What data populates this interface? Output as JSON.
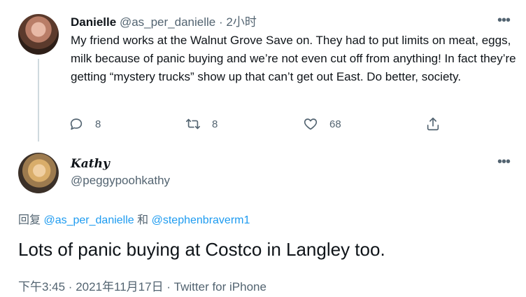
{
  "parent_tweet": {
    "display_name": "Danielle",
    "handle": "@as_per_danielle",
    "separator": "·",
    "time": "2小时",
    "text": "My friend works at the Walnut Grove Save on. They had to put limits on meat, eggs, milk because of panic buying and we’re not even cut off from anything! In fact they’re getting “mystery trucks” show up that can’t get out East. Do better, society.",
    "actions": {
      "reply_count": "8",
      "retweet_count": "8",
      "like_count": "68"
    }
  },
  "reply_tweet": {
    "display_name": "Kathy",
    "handle": "@peggypoohkathy",
    "replying_prefix": "回复",
    "mention_1": "@as_per_danielle",
    "conjunction": "和",
    "mention_2": "@stephenbraverm1",
    "text": "Lots of panic buying at Costco in Langley too.",
    "meta": "下午3:45 · 2021年11月17日 · Twitter for iPhone"
  },
  "icons": {
    "more": "more-horizontal-icon",
    "reply": "reply-bubble-icon",
    "retweet": "retweet-icon",
    "like": "heart-icon",
    "share": "share-icon"
  },
  "colors": {
    "text": "#0f1419",
    "secondary": "#536471",
    "link": "#1d9bf0",
    "thread_line": "#cfd9de"
  }
}
